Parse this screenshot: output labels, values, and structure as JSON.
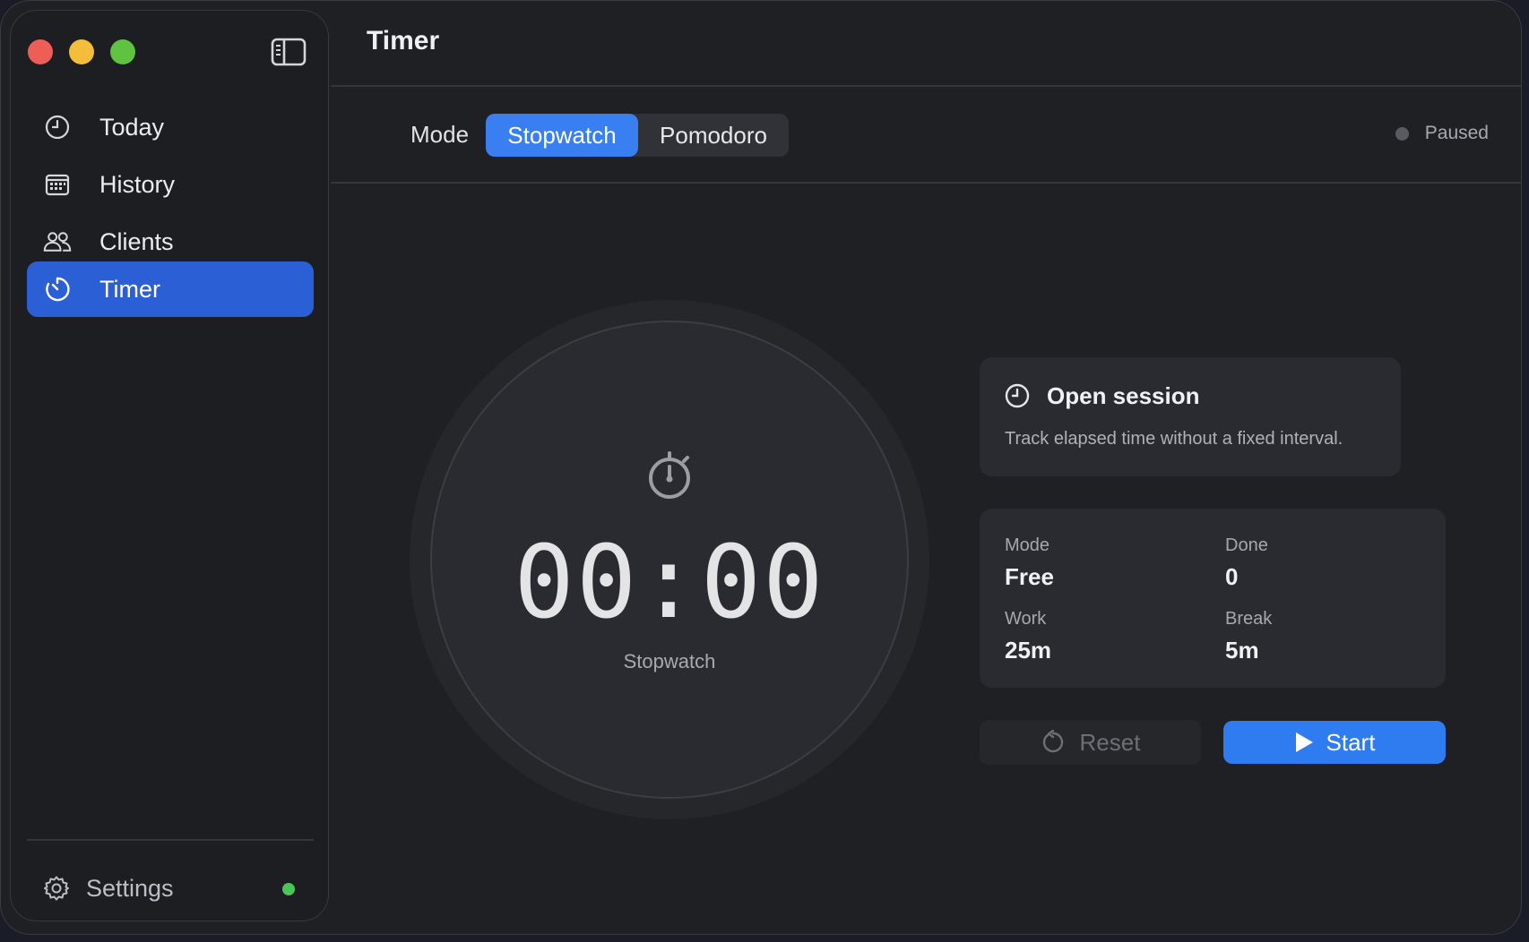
{
  "window": {
    "title": "Timer"
  },
  "sidebar": {
    "items": [
      {
        "label": "Today",
        "icon": "clock-icon"
      },
      {
        "label": "History",
        "icon": "calendar-icon"
      },
      {
        "label": "Clients",
        "icon": "people-icon"
      },
      {
        "label": "Timer",
        "icon": "timer-icon",
        "active": true
      }
    ],
    "settings_label": "Settings",
    "status_color": "#4cc45a"
  },
  "modebar": {
    "label": "Mode",
    "options": [
      "Stopwatch",
      "Pomodoro"
    ],
    "selected": "Stopwatch",
    "status": "Paused"
  },
  "dial": {
    "time": "00:00",
    "caption": "Stopwatch"
  },
  "session_card": {
    "title": "Open session",
    "description": "Track elapsed time without a fixed interval."
  },
  "stats": {
    "mode": {
      "label": "Mode",
      "value": "Free"
    },
    "done": {
      "label": "Done",
      "value": "0"
    },
    "work": {
      "label": "Work",
      "value": "25m"
    },
    "break": {
      "label": "Break",
      "value": "5m"
    }
  },
  "actions": {
    "reset_label": "Reset",
    "start_label": "Start"
  },
  "colors": {
    "accent": "#3a7ff2",
    "sidebar_active": "#2b5fd6"
  }
}
